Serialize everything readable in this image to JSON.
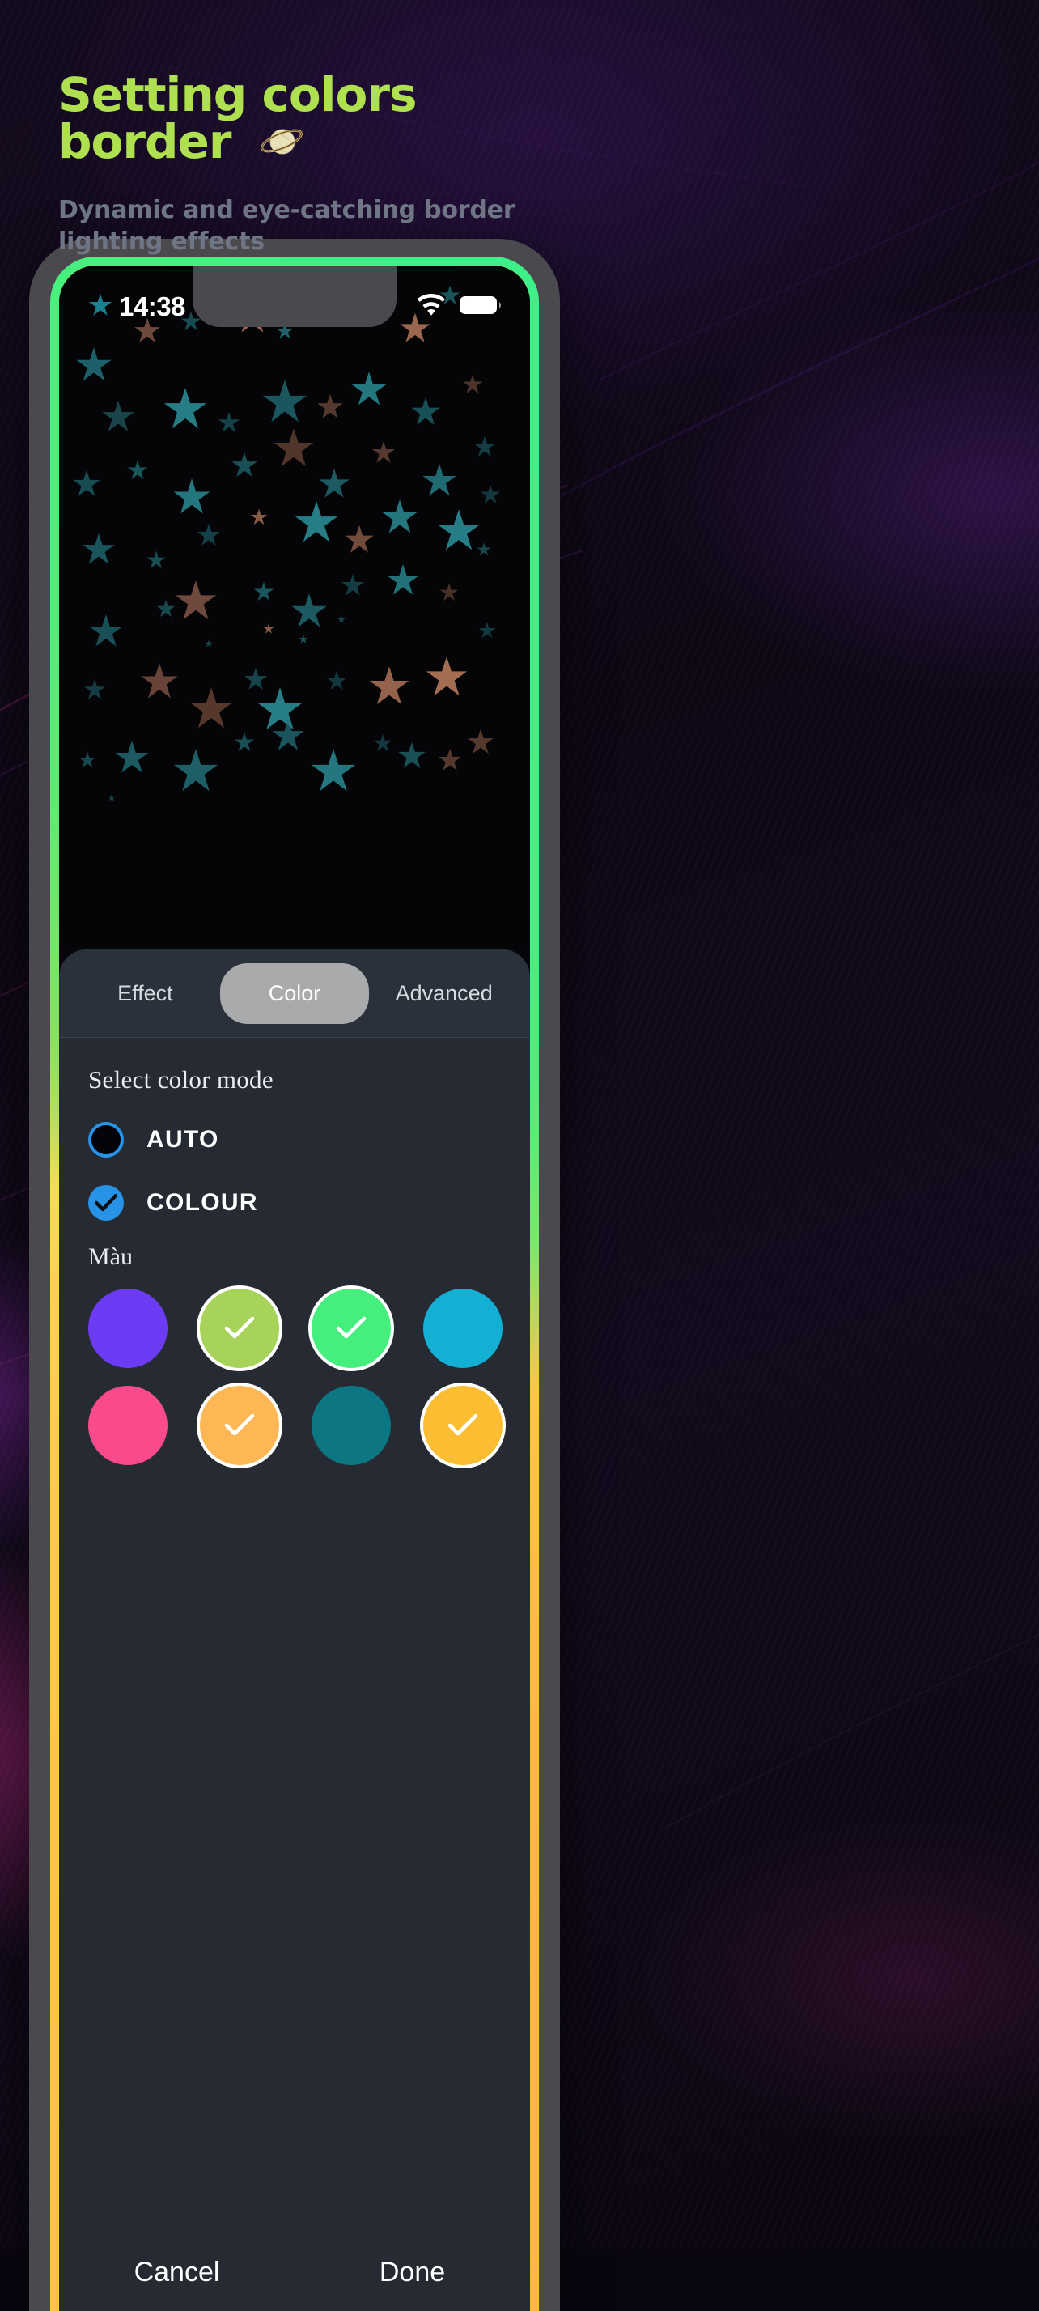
{
  "page": {
    "title_line1": "Setting colors",
    "title_line2": "border",
    "title_emoji": "saturn-planet-emoji",
    "subtitle_line1": "Dynamic and eye-catching border",
    "subtitle_line2": "lighting effects",
    "title_color": "#aee04f",
    "subtitle_color": "#6e7585"
  },
  "phone": {
    "status_bar": {
      "time": "14:38",
      "star_icon": "star-icon",
      "wifi_icon": "wifi-icon",
      "battery_icon": "battery-full-icon"
    },
    "border_glow": {
      "colors": [
        "#ffd24a",
        "#8fe05a",
        "#3cf08a",
        "#ffc83c",
        "#ffb73a"
      ]
    },
    "wallpaper": {
      "name": "stars-wallpaper",
      "background": "#050508",
      "star_colors": [
        "#1c6b72",
        "#2a8f99",
        "#8a5a4a",
        "#c98a6a"
      ]
    }
  },
  "sheet": {
    "tabs": [
      {
        "label": "Effect",
        "active": false
      },
      {
        "label": "Color",
        "active": true
      },
      {
        "label": "Advanced",
        "active": false
      }
    ],
    "section_title": "Select color mode",
    "modes": [
      {
        "label": "AUTO",
        "selected": false
      },
      {
        "label": "COLOUR",
        "selected": true
      }
    ],
    "swatch_label": "Màu",
    "swatch_rows": [
      [
        {
          "color": "#6c3cf5",
          "selected": false
        },
        {
          "color": "#a8d35a",
          "selected": true
        },
        {
          "color": "#44ef7e",
          "selected": true
        },
        {
          "color": "#14b0d4",
          "selected": false
        },
        {
          "color": "#fb7a4d",
          "selected": false
        }
      ],
      [
        {
          "color": "#f94b8c",
          "selected": false
        },
        {
          "color": "#fdb855",
          "selected": true
        },
        {
          "color": "#0d7683",
          "selected": false
        },
        {
          "color": "#fbbd32",
          "selected": true
        },
        {
          "color": "#f0361f",
          "selected": false
        }
      ]
    ],
    "actions": [
      {
        "label": "Cancel"
      },
      {
        "label": "Done"
      }
    ],
    "accent_checked": "#2693e6",
    "sheet_bg": "#262b33",
    "tabbar_bg": "#2b313a",
    "active_tab_bg": "#a9aaac"
  }
}
